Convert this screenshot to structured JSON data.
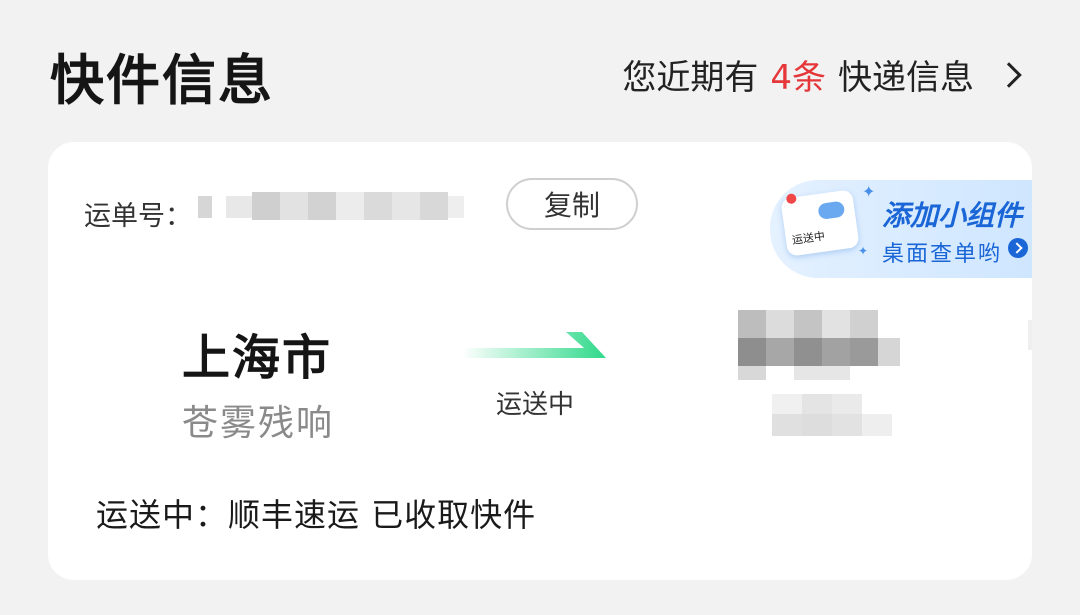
{
  "header": {
    "title": "快件信息",
    "summary_prefix": "您近期有",
    "summary_count": "4条",
    "summary_suffix": "快递信息",
    "chevron_icon": "chevron-right-icon"
  },
  "shipment": {
    "waybill_label": "运单号：",
    "copy_label": "复制",
    "origin_city": "上海市",
    "origin_sub": "苍雾残响",
    "transit_label": "运送中",
    "status_text": "运送中：顺丰速运 已收取快件"
  },
  "widget_banner": {
    "title": "添加小组件",
    "subtitle": "桌面查单哟",
    "thumb_label": "运送中"
  },
  "colors": {
    "accent_count": "#e5373a",
    "route_arrow": "#2fd98a",
    "widget_text": "#1a66d6"
  }
}
